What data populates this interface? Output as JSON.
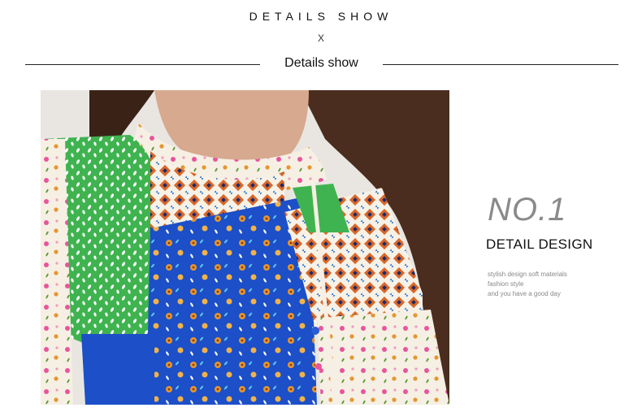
{
  "header": {
    "title": "DETAILS SHOW",
    "separator": "X",
    "subtitle": "Details show"
  },
  "photo": {
    "description_icon": "patchwork-blouse-photo",
    "colors": {
      "green": "#3fb34f",
      "blue": "#1c4fc8",
      "orange": "#e5962e",
      "pink": "#e8559c",
      "cream": "#f6efe3",
      "hair": "#4a2d1e",
      "skin": "#d7a98f"
    }
  },
  "feature": {
    "number": "NO.1",
    "heading": "DETAIL DESIGN",
    "lines": [
      "stylish design soft materials",
      "fashion style",
      "and you have a good day"
    ]
  }
}
